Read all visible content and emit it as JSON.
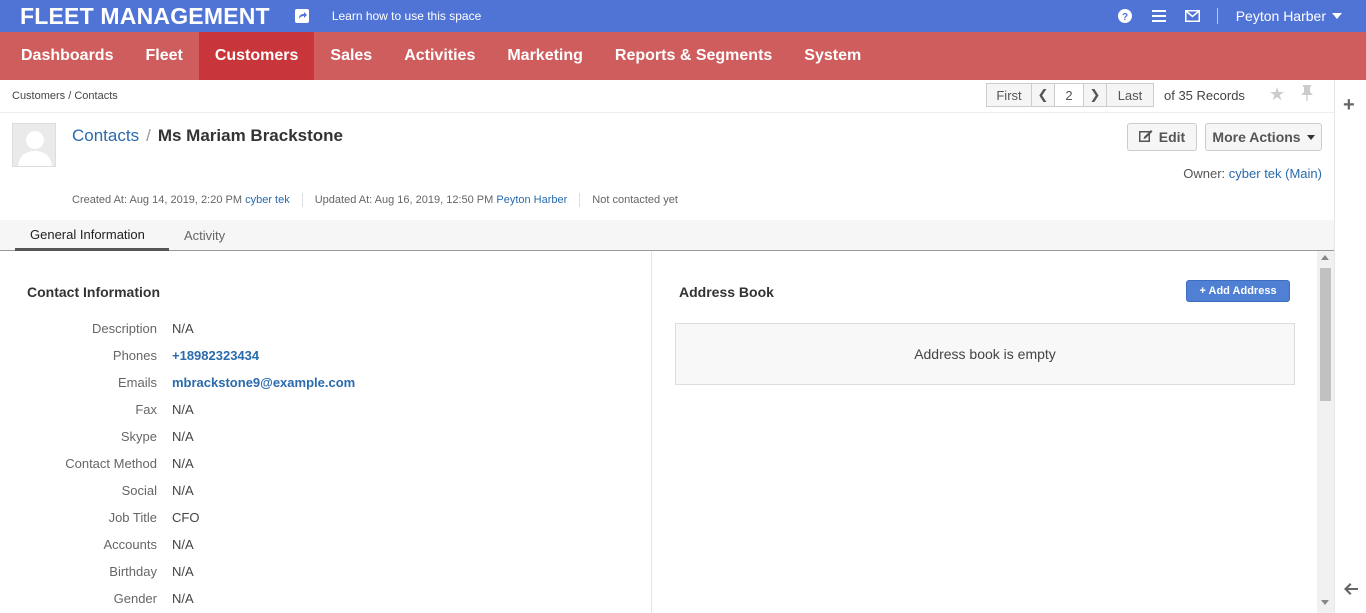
{
  "topbar": {
    "brand": "FLEET MANAGEMENT",
    "learn_link": "Learn how to use this space",
    "user_name": "Peyton Harber",
    "icons": [
      "share-icon",
      "help-icon",
      "menu-icon",
      "mail-icon"
    ]
  },
  "nav": {
    "items": [
      "Dashboards",
      "Fleet",
      "Customers",
      "Sales",
      "Activities",
      "Marketing",
      "Reports & Segments",
      "System"
    ],
    "active": "Customers"
  },
  "breadcrumb": "Customers / Contacts",
  "pager": {
    "first": "First",
    "current": "2",
    "last": "Last",
    "records": "of 35 Records"
  },
  "header": {
    "section_link": "Contacts",
    "separator": "/",
    "record_name": "Ms Mariam Brackstone",
    "edit_label": "Edit",
    "more_actions_label": "More Actions",
    "owner_label": "Owner:",
    "owner_value": "cyber tek (Main)",
    "created_label": "Created At: Aug 14, 2019, 2:20 PM",
    "created_by": "cyber tek",
    "updated_label": "Updated At: Aug 16, 2019, 12:50 PM",
    "updated_by": "Peyton Harber",
    "contact_status": "Not contacted yet"
  },
  "tabs": [
    "General Information",
    "Activity"
  ],
  "contact_info": {
    "title": "Contact Information",
    "fields": [
      {
        "label": "Description",
        "value": "N/A"
      },
      {
        "label": "Phones",
        "value": "+18982323434"
      },
      {
        "label": "Emails",
        "value": "mbrackstone9@example.com"
      },
      {
        "label": "Fax",
        "value": "N/A"
      },
      {
        "label": "Skype",
        "value": "N/A"
      },
      {
        "label": "Contact Method",
        "value": "N/A"
      },
      {
        "label": "Social",
        "value": "N/A"
      },
      {
        "label": "Job Title",
        "value": "CFO"
      },
      {
        "label": "Accounts",
        "value": "N/A"
      },
      {
        "label": "Birthday",
        "value": "N/A"
      },
      {
        "label": "Gender",
        "value": "N/A"
      }
    ]
  },
  "address_book": {
    "title": "Address Book",
    "add_label": "+ Add Address",
    "empty_text": "Address book is empty"
  },
  "colors": {
    "topbar": "#5074d6",
    "nav": "#d05d5d",
    "nav_active": "#c8353a",
    "link": "#2a6aad",
    "add_button": "#4f80d4"
  }
}
